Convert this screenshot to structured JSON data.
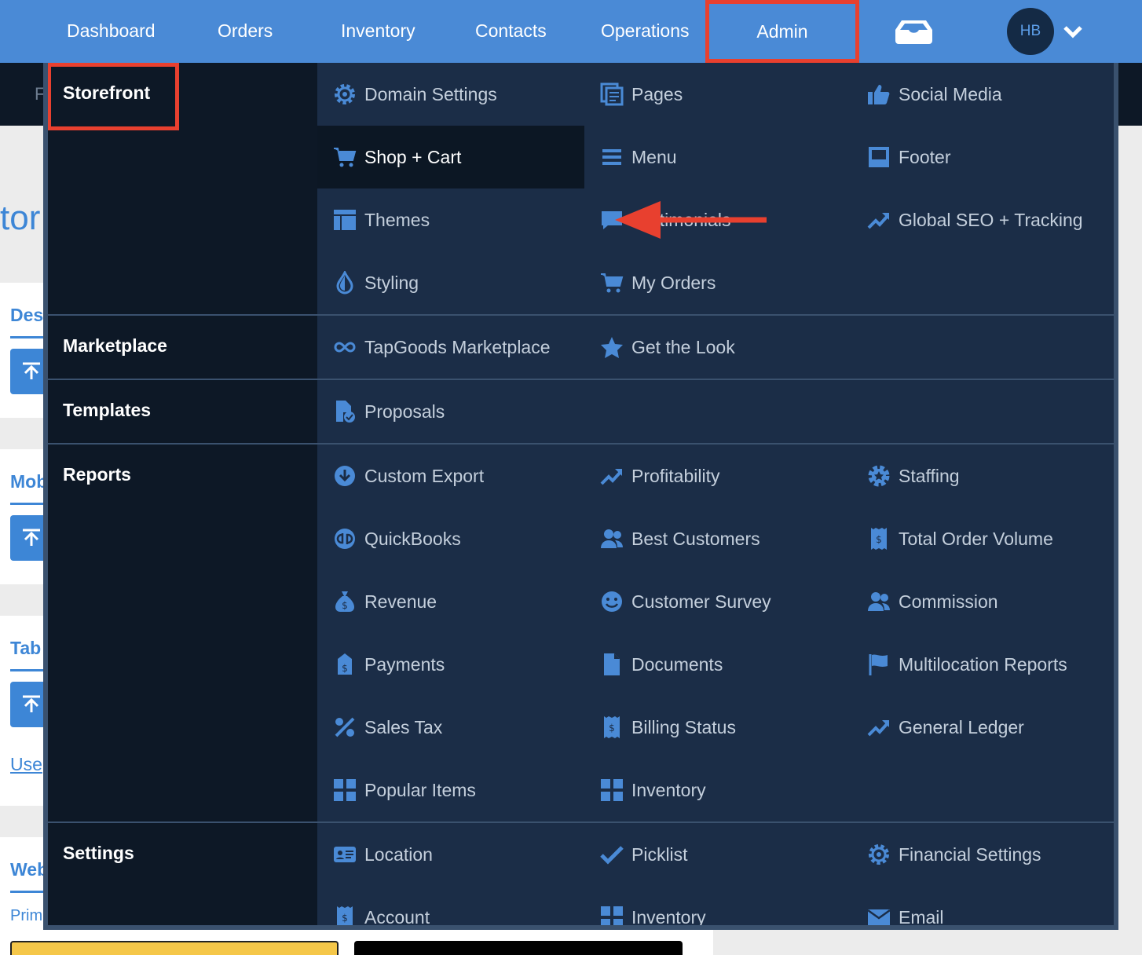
{
  "nav": {
    "items": [
      "Dashboard",
      "Orders",
      "Inventory",
      "Contacts",
      "Operations"
    ],
    "active": "Admin",
    "avatar": "HB"
  },
  "background": {
    "subbar_letter": "F",
    "title_fragment": "tor",
    "sections": [
      "Des",
      "Mob",
      "Tab",
      "Web"
    ],
    "link": "Use",
    "primary": "Prim"
  },
  "menu": {
    "categories": [
      "Storefront",
      "Marketplace",
      "Templates",
      "Reports",
      "Settings"
    ],
    "storefront": {
      "col1": [
        "Domain Settings",
        "Shop + Cart",
        "Themes",
        "Styling"
      ],
      "col2": [
        "Pages",
        "Menu",
        "Testimonials",
        "My Orders"
      ],
      "col3": [
        "Social Media",
        "Footer",
        "Global SEO + Tracking"
      ]
    },
    "marketplace": [
      "TapGoods Marketplace",
      "Get the Look"
    ],
    "templates": [
      "Proposals"
    ],
    "reports": {
      "col1": [
        "Custom Export",
        "QuickBooks",
        "Revenue",
        "Payments",
        "Sales Tax",
        "Popular Items"
      ],
      "col2": [
        "Profitability",
        "Best Customers",
        "Customer Survey",
        "Documents",
        "Billing Status",
        "Inventory"
      ],
      "col3": [
        "Staffing",
        "Total Order Volume",
        "Commission",
        "Multilocation Reports",
        "General Ledger"
      ]
    },
    "settings": {
      "col1": [
        "Location",
        "Account"
      ],
      "col2": [
        "Picklist",
        "Inventory"
      ],
      "col3": [
        "Financial Settings",
        "Email"
      ]
    }
  },
  "icons": {
    "domain": "gear-icon",
    "shop": "cart-icon",
    "themes": "layout-icon",
    "styling": "drop-icon",
    "pages": "pages-icon",
    "menu": "menu-icon",
    "testimonials": "chat-icon",
    "orders": "cart-icon",
    "social": "thumbs-up-icon",
    "footer": "footer-icon",
    "seo": "trend-icon"
  },
  "colors": {
    "nav": "#4a8ad6",
    "menu": "#1b2d47",
    "menu_left": "#0d1826",
    "highlight": "#e8402f",
    "icon": "#4a8ad6"
  }
}
